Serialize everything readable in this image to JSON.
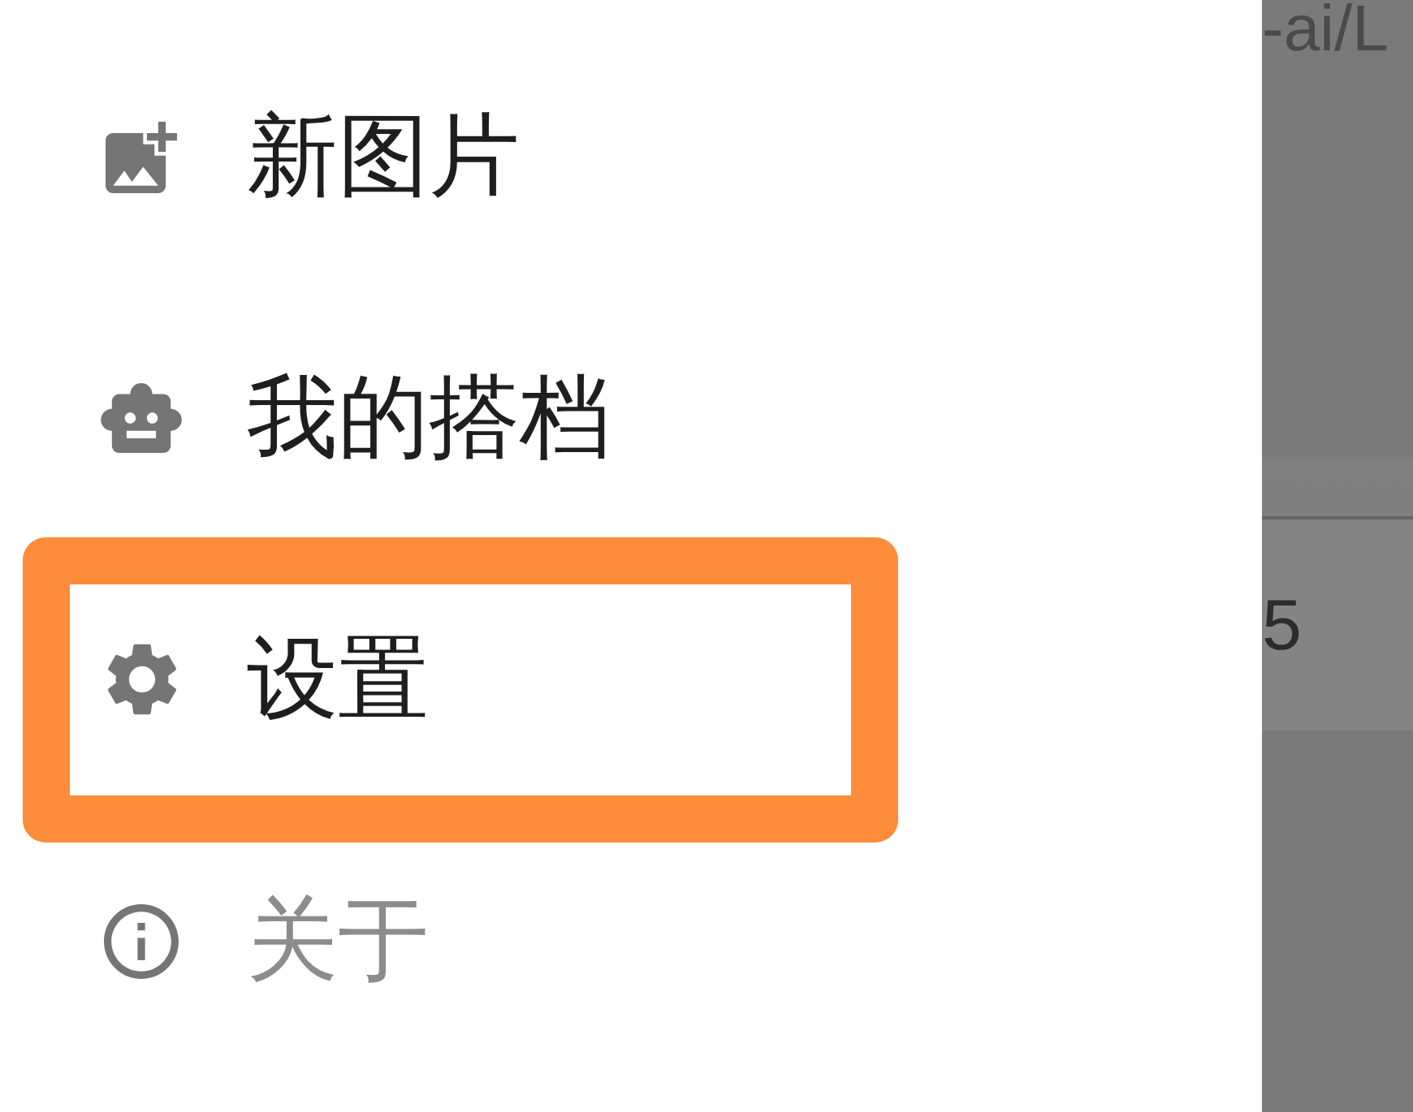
{
  "drawer": {
    "items": [
      {
        "kind": "new-image",
        "label": "新图片",
        "highlighted": false,
        "disabled": false
      },
      {
        "kind": "partner",
        "label": "我的搭档",
        "highlighted": false,
        "disabled": false
      },
      {
        "kind": "settings",
        "label": "设置",
        "highlighted": true,
        "disabled": false
      },
      {
        "kind": "about",
        "label": "关于",
        "highlighted": false,
        "disabled": true
      }
    ]
  },
  "background_app": {
    "top_text": "-ai/L",
    "middle_text": "5"
  }
}
